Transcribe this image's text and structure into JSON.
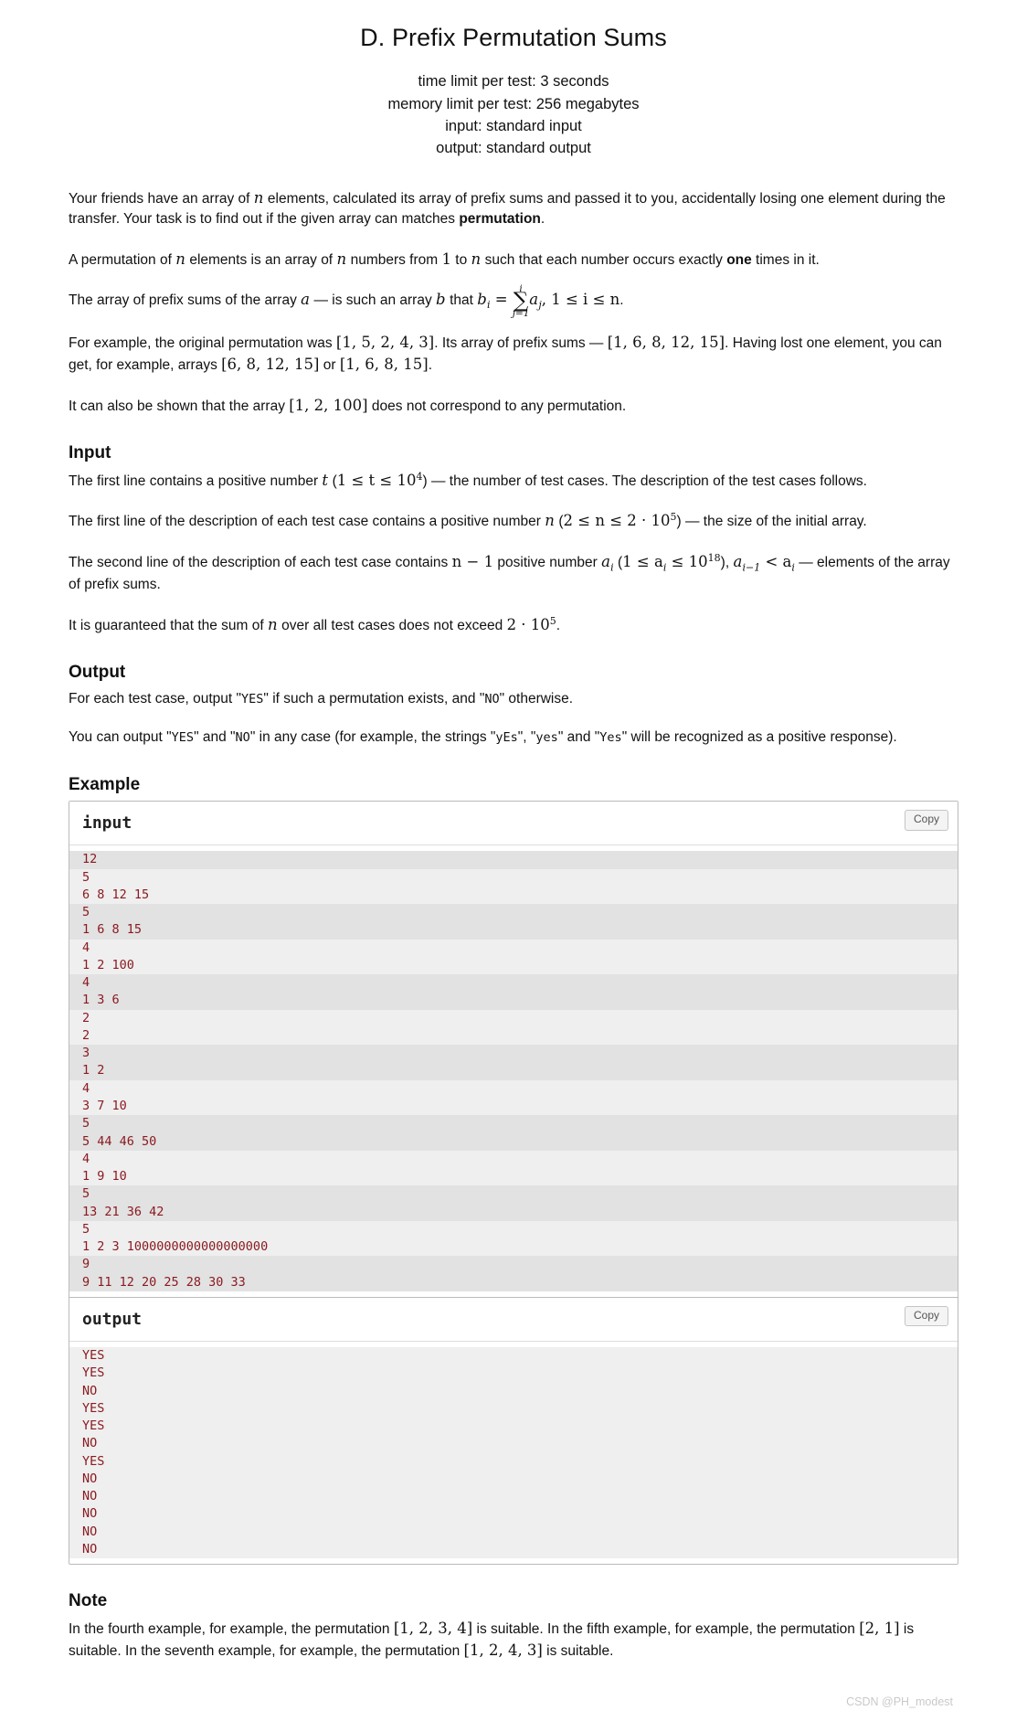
{
  "header": {
    "title": "D. Prefix Permutation Sums",
    "time_limit": "time limit per test: 3 seconds",
    "memory_limit": "memory limit per test: 256 megabytes",
    "input_spec": "input: standard input",
    "output_spec": "output: standard output"
  },
  "statement": {
    "p1_a": "Your friends have an array of ",
    "p1_n": "n",
    "p1_b": " elements, calculated its array of prefix sums and passed it to you, accidentally losing one element during the transfer. Your task is to find out if the given array can matches ",
    "p1_bold": "permutation",
    "p1_c": ".",
    "p2_a": "A permutation of ",
    "p2_n1": "n",
    "p2_b": " elements is an array of ",
    "p2_n2": "n",
    "p2_c": " numbers from ",
    "p2_one": "1",
    "p2_d": " to ",
    "p2_n3": "n",
    "p2_e": " such that each number occurs exactly ",
    "p2_bold": "one",
    "p2_f": " times in it.",
    "p3_a": "The array of prefix sums of the array ",
    "p3_a_var": "a",
    "p3_b": " — is such an array ",
    "p3_b_var": "b",
    "p3_c": " that ",
    "p3_bi": "b",
    "p3_bi_sub": "i",
    "p3_eq": " = ",
    "p3_sum_top": "i",
    "p3_sum_bot": "j=1",
    "p3_aj": "a",
    "p3_aj_sub": "j",
    "p3_tail": ", 1 ≤ i ≤ n",
    "p3_period": ".",
    "p4_a": "For example, the original permutation was ",
    "p4_perm": "[1, 5, 2, 4, 3]",
    "p4_b": ". Its array of prefix sums — ",
    "p4_sums": "[1, 6, 8, 12, 15]",
    "p4_c": ". Having lost one element, you can get, for example, arrays ",
    "p4_arr1": "[6, 8, 12, 15]",
    "p4_d": " or ",
    "p4_arr2": "[1, 6, 8, 15]",
    "p4_e": ".",
    "p5_a": "It can also be shown that the array ",
    "p5_arr": "[1, 2, 100]",
    "p5_b": " does not correspond to any permutation."
  },
  "input_section": {
    "heading": "Input",
    "l1_a": "The first line contains a positive number ",
    "l1_t": "t",
    "l1_b": " (",
    "l1_cond": "1 ≤ t ≤ 10",
    "l1_exp": "4",
    "l1_c": ") — the number of test cases. The description of the test cases follows.",
    "l2_a": "The first line of the description of each test case contains a positive number ",
    "l2_n": "n",
    "l2_b": " (",
    "l2_cond": "2 ≤ n ≤ 2 · 10",
    "l2_exp": "5",
    "l2_c": ") — the size of the initial array.",
    "l3_a": "The second line of the description of each test case contains ",
    "l3_nm1": "n − 1",
    "l3_b": " positive number ",
    "l3_ai": "a",
    "l3_ai_sub": "i",
    "l3_c": " (",
    "l3_cond": "1 ≤ a",
    "l3_cond_sub": "i",
    "l3_cond2": " ≤ 10",
    "l3_exp": "18",
    "l3_d": "), ",
    "l3_mono": "a",
    "l3_mono_sub": "i−1",
    "l3_mono2": " < a",
    "l3_mono2_sub": "i",
    "l3_e": " — elements of the array of prefix sums.",
    "l4_a": "It is guaranteed that the sum of ",
    "l4_n": "n",
    "l4_b": " over all test cases does not exceed ",
    "l4_val": "2 · 10",
    "l4_exp": "5",
    "l4_c": "."
  },
  "output_section": {
    "heading": "Output",
    "o1_a": "For each test case, output \"",
    "o1_yes": "YES",
    "o1_b": "\" if such a permutation exists, and \"",
    "o1_no": "NO",
    "o1_c": "\" otherwise.",
    "o2_a": "You can output \"",
    "o2_yes": "YES",
    "o2_b": "\" and \"",
    "o2_no": "NO",
    "o2_c": "\" in any case (for example, the strings \"",
    "o2_s1": "yEs",
    "o2_d": "\", \"",
    "o2_s2": "yes",
    "o2_e": "\" and \"",
    "o2_s3": "Yes",
    "o2_f": "\" will be recognized as a positive response)."
  },
  "example": {
    "heading": "Example",
    "input_label": "input",
    "output_label": "output",
    "copy_label": "Copy",
    "input_lines": [
      "12",
      "5",
      "6 8 12 15",
      "5",
      "1 6 8 15",
      "4",
      "1 2 100",
      "4",
      "1 3 6",
      "2",
      "2",
      "3",
      "1 2",
      "4",
      "3 7 10",
      "5",
      "5 44 46 50",
      "4",
      "1 9 10",
      "5",
      "13 21 36 42",
      "5",
      "1 2 3 1000000000000000000",
      "9",
      "9 11 12 20 25 28 30 33"
    ],
    "output_lines": [
      "YES",
      "YES",
      "NO",
      "YES",
      "YES",
      "NO",
      "YES",
      "NO",
      "NO",
      "NO",
      "NO",
      "NO"
    ]
  },
  "note_section": {
    "heading": "Note",
    "n_a": "In the fourth example, for example, the permutation ",
    "n_p1": "[1, 2, 3, 4]",
    "n_b": " is suitable. In the fifth example, for example, the permutation ",
    "n_p2": "[2, 1]",
    "n_c": " is suitable. In the seventh example, for example, the permutation ",
    "n_p3": "[1, 2, 4, 3]",
    "n_d": " is suitable."
  },
  "watermark": {
    "text": "CSDN @PH_modest"
  },
  "colors": {
    "code_text": "#8b1a20",
    "row_odd": "#e2e2e2",
    "row_even": "#efefef",
    "border": "#bbbbbb"
  }
}
